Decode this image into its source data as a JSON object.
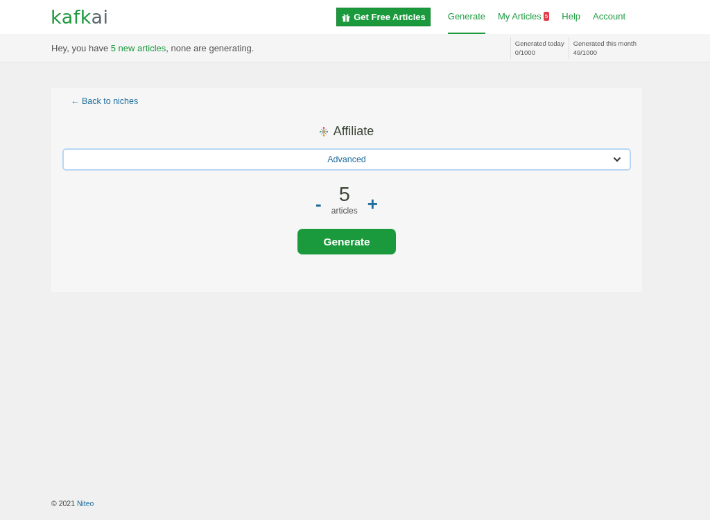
{
  "logo": {
    "primary": "kafk",
    "secondary": "ai"
  },
  "promo_button": {
    "label": "Get Free Articles"
  },
  "nav": [
    {
      "label": "Generate",
      "selected": true
    },
    {
      "label": "My Articles",
      "selected": false,
      "badge": "5"
    },
    {
      "label": "Help",
      "selected": false
    },
    {
      "label": "Account",
      "selected": false
    }
  ],
  "notice": {
    "prefix": "Hey, you have ",
    "link": "5 new articles",
    "suffix": ", none are generating."
  },
  "stats": [
    {
      "label": "Generated today",
      "value": "0/1000"
    },
    {
      "label": "Generated this month",
      "value": "49/1000"
    }
  ],
  "back_link": "← Back to niches",
  "niche_title": "Affiliate",
  "advanced": {
    "label": "Advanced",
    "expanded": false
  },
  "counter": {
    "minus": "-",
    "value": "5",
    "unit": "articles",
    "plus": "+"
  },
  "generate_button": "Generate",
  "footer": {
    "copyright": "© 2021 ",
    "link": "Niteo"
  }
}
